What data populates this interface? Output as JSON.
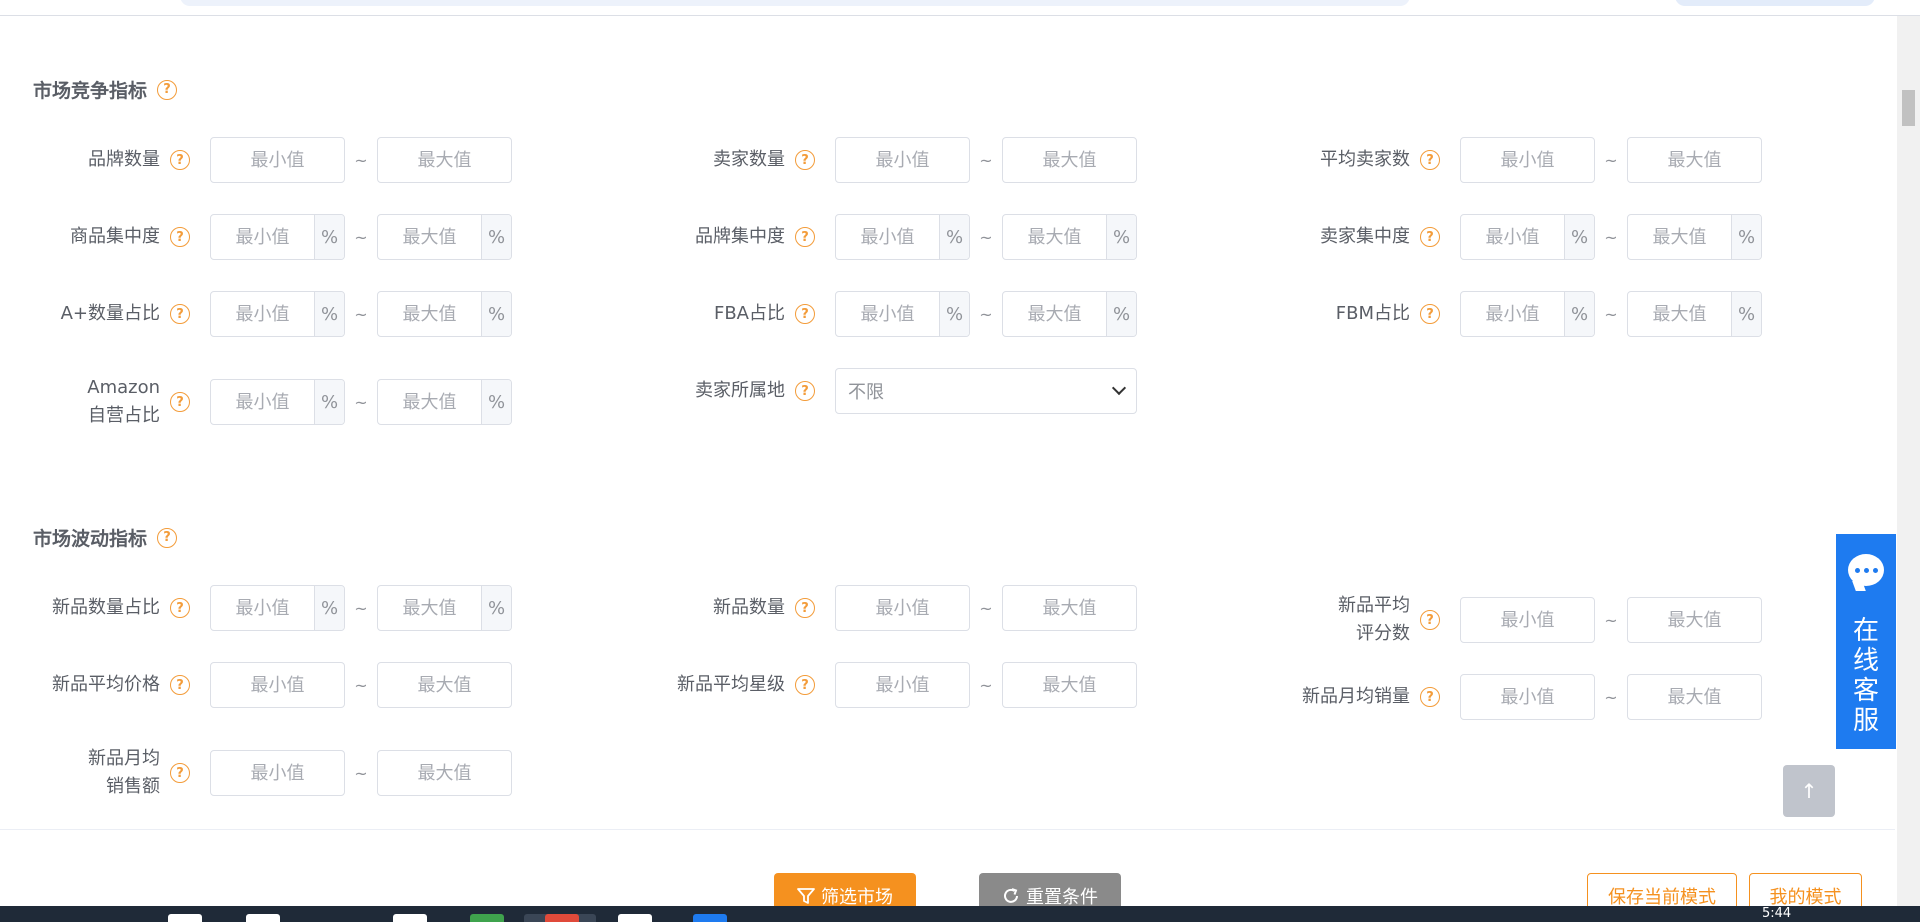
{
  "sections": {
    "competition": "市场竞争指标",
    "fluctuation": "市场波动指标"
  },
  "placeholders": {
    "min": "最小值",
    "max": "最大值"
  },
  "unit": "%",
  "tilde": "~",
  "fields": {
    "brand_count": "品牌数量",
    "seller_count": "卖家数量",
    "avg_seller_count": "平均卖家数",
    "product_concentration": "商品集中度",
    "brand_concentration": "品牌集中度",
    "seller_concentration": "卖家集中度",
    "aplus_ratio": "A+数量占比",
    "fba_ratio": "FBA占比",
    "fbm_ratio": "FBM占比",
    "amazon_ratio_1": "Amazon",
    "amazon_ratio_2": "自营占比",
    "seller_location": "卖家所属地",
    "seller_location_value": "不限",
    "new_count_ratio": "新品数量占比",
    "new_count": "新品数量",
    "new_avg_rating_1": "新品平均",
    "new_avg_rating_2": "评分数",
    "new_avg_price": "新品平均价格",
    "new_avg_star": "新品平均星级",
    "new_monthly_sales": "新品月均销量",
    "new_monthly_revenue_1": "新品月均",
    "new_monthly_revenue_2": "销售额"
  },
  "question_mark": "?",
  "buttons": {
    "filter": "筛选市场",
    "reset": "重置条件",
    "save_mode": "保存当前模式",
    "my_mode": "我的模式"
  },
  "service": "在线客服",
  "taskbar_clock": "5:44",
  "colors": {
    "accent": "#f5911f",
    "service_blue": "#1e7bf0",
    "question_orange": "#f39c3a"
  }
}
